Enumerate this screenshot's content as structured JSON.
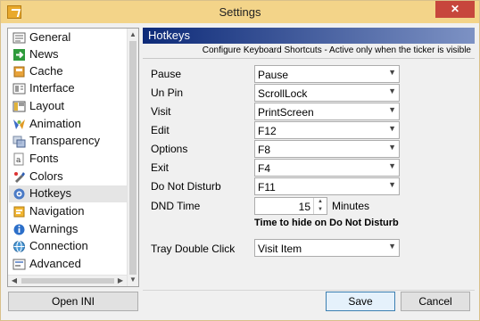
{
  "window": {
    "title": "Settings",
    "close_label": "✕"
  },
  "sidebar": {
    "items": [
      {
        "label": "General",
        "icon": "general-icon",
        "selected": false
      },
      {
        "label": "News",
        "icon": "news-icon",
        "selected": false
      },
      {
        "label": "Cache",
        "icon": "cache-icon",
        "selected": false
      },
      {
        "label": "Interface",
        "icon": "interface-icon",
        "selected": false
      },
      {
        "label": "Layout",
        "icon": "layout-icon",
        "selected": false
      },
      {
        "label": "Animation",
        "icon": "animation-icon",
        "selected": false
      },
      {
        "label": "Transparency",
        "icon": "transparency-icon",
        "selected": false
      },
      {
        "label": "Fonts",
        "icon": "fonts-icon",
        "selected": false
      },
      {
        "label": "Colors",
        "icon": "colors-icon",
        "selected": false
      },
      {
        "label": "Hotkeys",
        "icon": "hotkeys-icon",
        "selected": true
      },
      {
        "label": "Navigation",
        "icon": "navigation-icon",
        "selected": false
      },
      {
        "label": "Warnings",
        "icon": "warnings-icon",
        "selected": false
      },
      {
        "label": "Connection",
        "icon": "connection-icon",
        "selected": false
      },
      {
        "label": "Advanced",
        "icon": "advanced-icon",
        "selected": false
      }
    ]
  },
  "panel": {
    "title": "Hotkeys",
    "subtitle": "Configure Keyboard Shortcuts - Active only when the ticker is visible"
  },
  "hotkeys": {
    "pause": {
      "label": "Pause",
      "value": "Pause"
    },
    "unpin": {
      "label": "Un Pin",
      "value": "ScrollLock"
    },
    "visit": {
      "label": "Visit",
      "value": "PrintScreen"
    },
    "edit": {
      "label": "Edit",
      "value": "F12"
    },
    "options": {
      "label": "Options",
      "value": "F8"
    },
    "exit": {
      "label": "Exit",
      "value": "F4"
    },
    "dnd": {
      "label": "Do Not Disturb",
      "value": "F11"
    }
  },
  "dnd_time": {
    "label": "DND Time",
    "value": "15",
    "unit": "Minutes",
    "hint": "Time to hide on Do Not Disturb"
  },
  "tray": {
    "label": "Tray Double Click",
    "value": "Visit Item"
  },
  "buttons": {
    "open_ini": "Open INI",
    "save": "Save",
    "cancel": "Cancel"
  },
  "colors": {
    "titlebar": "#f3d489",
    "header_start": "#0d2a78",
    "header_end": "#7d92c4",
    "close": "#c7463c"
  }
}
